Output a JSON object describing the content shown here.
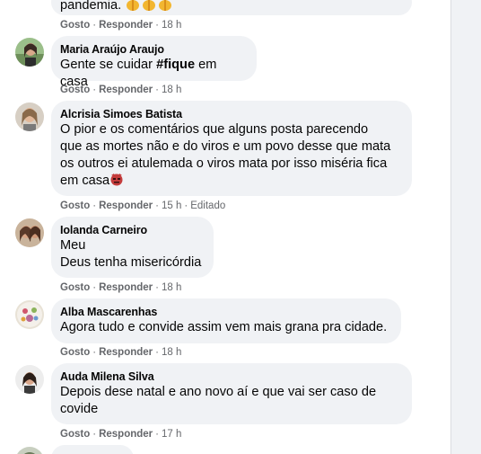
{
  "top_fragment": {
    "text": "pandemia.",
    "actions": {
      "like": "Gosto",
      "reply": "Responder",
      "time": "18 h"
    }
  },
  "comments": [
    {
      "author": "Maria Araújo Araujo",
      "text_before": "Gente se cuidar ",
      "hashtag": "#fique",
      "text_after": " em casa",
      "actions": {
        "like": "Gosto",
        "reply": "Responder",
        "time": "18 h"
      }
    },
    {
      "author": "Alcrisia Simoes Batista",
      "lines": [
        "O pior e os comentários que alguns posta parecendo",
        "que as mortes não e do viros e um povo desse que mata",
        "os outros ei atulemada o viros mata por isso miséria fica",
        "em casa"
      ],
      "actions": {
        "like": "Gosto",
        "reply": "Responder",
        "time": "15 h",
        "edited": "Editado"
      }
    },
    {
      "author": "Iolanda Carneiro",
      "lines": [
        "Meu",
        "Deus tenha misericórdia"
      ],
      "actions": {
        "like": "Gosto",
        "reply": "Responder",
        "time": "18 h"
      }
    },
    {
      "author": "Alba Mascarenhas",
      "lines": [
        "Agora tudo e convide assim vem mais grana pra cidade."
      ],
      "actions": {
        "like": "Gosto",
        "reply": "Responder",
        "time": "18 h"
      }
    },
    {
      "author": "Auda Milena Silva",
      "lines": [
        "Depois dese natal e ano novo aí e que vai ser caso de",
        "covide"
      ],
      "actions": {
        "like": "Gosto",
        "reply": "Responder",
        "time": "17 h"
      }
    }
  ],
  "colors": {
    "bubble": "#f0f2f5",
    "meta_text": "#65676b",
    "name_text": "#050505",
    "emoji_prayer": "#f2b630",
    "emoji_angry": "#c43c3c"
  },
  "icons": [
    "prayer-hands-emoji",
    "angry-face-emoji"
  ]
}
